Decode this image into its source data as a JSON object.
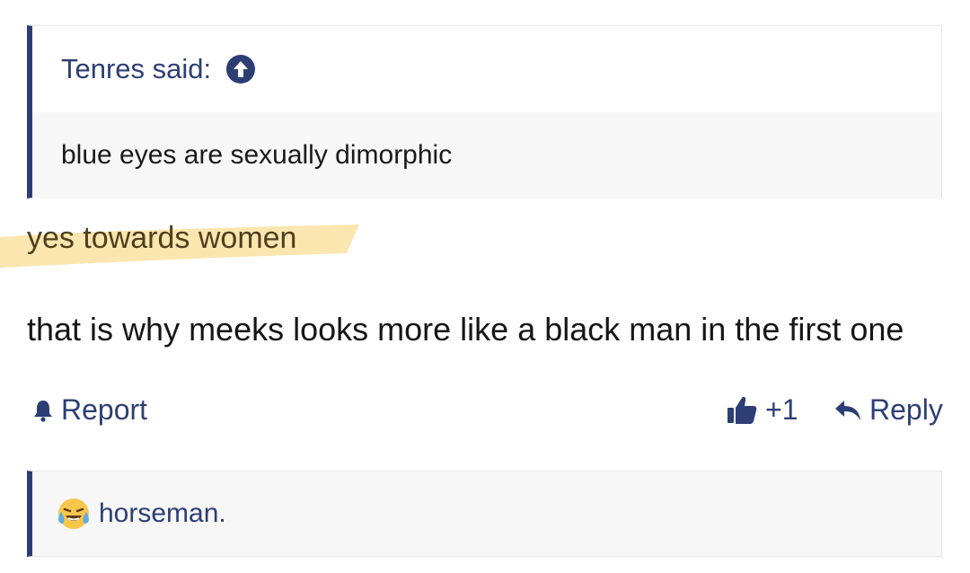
{
  "quote": {
    "author_label": "Tenres said:",
    "text": "blue eyes are sexually dimorphic"
  },
  "post": {
    "highlighted_line": "yes towards women",
    "line": "that is why meeks looks more like a black man in the first one"
  },
  "actions": {
    "report_label": "Report",
    "like_count": "+1",
    "reply_label": "Reply"
  },
  "reactions": {
    "user": "horseman."
  },
  "colors": {
    "accent": "#2d3e75",
    "highlight": "#fbe3a6"
  }
}
